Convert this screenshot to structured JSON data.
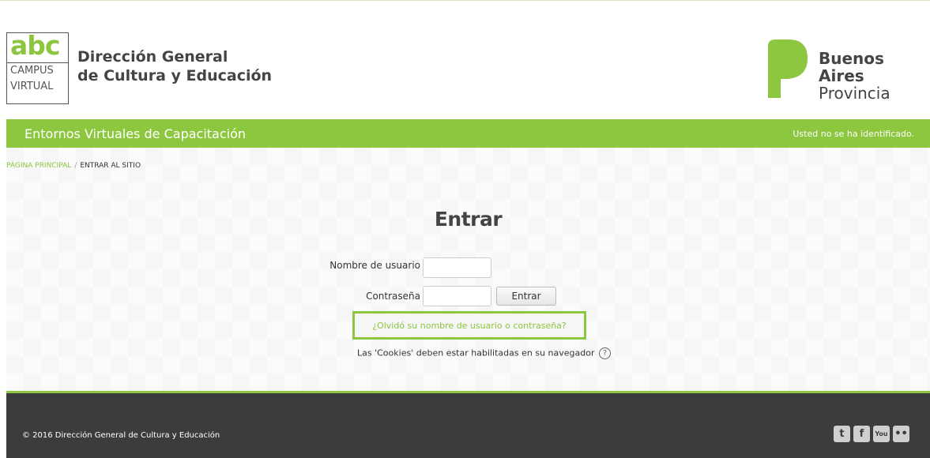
{
  "header": {
    "abc_logo": {
      "abc": "abc",
      "campus": "CAMPUS",
      "virtual": "VIRTUAL"
    },
    "org_title_line1": "Dirección General",
    "org_title_line2": "de Cultura y Educación",
    "province_line1": "Buenos Aires",
    "province_line2": "Provincia"
  },
  "navbar": {
    "site_name": "Entornos Virtuales de Capacitación",
    "login_info": "Usted no se ha identificado."
  },
  "breadcrumb": {
    "home": "PÁGINA PRINCIPAL",
    "separator": "/",
    "current": "ENTRAR AL SITIO"
  },
  "login": {
    "title": "Entrar",
    "username_label": "Nombre de usuario",
    "username_value": "",
    "password_label": "Contraseña",
    "password_value": "",
    "submit_label": "Entrar",
    "forgot_link": "¿Olvidó su nombre de usuario o contraseña?",
    "cookies_notice": "Las 'Cookies' deben estar habilitadas en su navegador",
    "help_glyph": "?"
  },
  "footer": {
    "copyright": "© 2016 Dirección General de Cultura y Educación",
    "social": [
      {
        "icon": "twitter-icon",
        "glyph": "t"
      },
      {
        "icon": "facebook-icon",
        "glyph": "f"
      },
      {
        "icon": "youtube-icon",
        "glyph": "You"
      },
      {
        "icon": "flickr-icon",
        "glyph": "••"
      }
    ]
  },
  "colors": {
    "accent": "#8dc63f",
    "footer_bg": "#3c3c3c",
    "text": "#333333"
  }
}
